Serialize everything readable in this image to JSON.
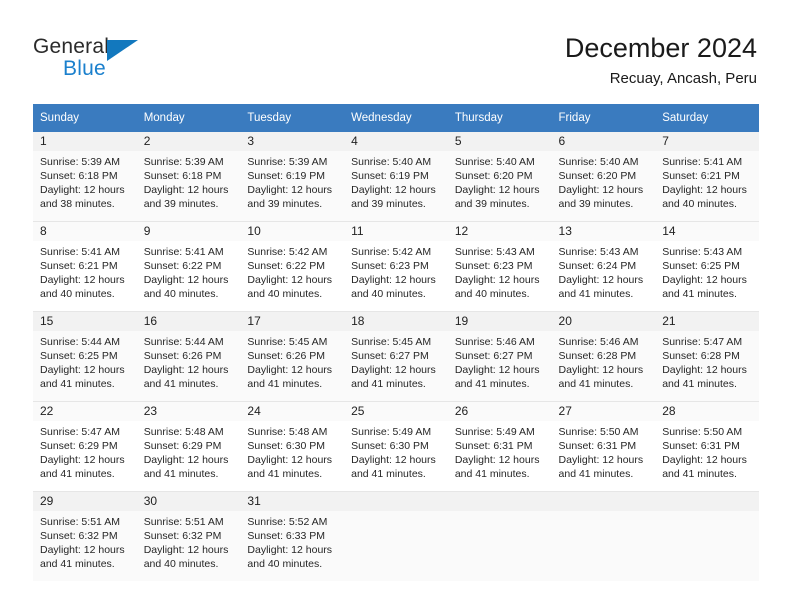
{
  "brand": {
    "name_part1": "General",
    "name_part2": "Blue",
    "triangle_color": "#1278be",
    "blue_color": "#1b80cd"
  },
  "header": {
    "title": "December 2024",
    "subtitle": "Recuay, Ancash, Peru"
  },
  "theme": {
    "header_bg": "#3a7bbf",
    "header_text": "#ffffff",
    "daynum_band": "#f2f2f2",
    "row_shaded": "#fafafa"
  },
  "weekdays": [
    "Sunday",
    "Monday",
    "Tuesday",
    "Wednesday",
    "Thursday",
    "Friday",
    "Saturday"
  ],
  "labels": {
    "sunrise_prefix": "Sunrise:",
    "sunset_prefix": "Sunset:",
    "daylight_prefix": "Daylight:"
  },
  "weeks": [
    [
      {
        "day": "1",
        "sunrise": "Sunrise: 5:39 AM",
        "sunset": "Sunset: 6:18 PM",
        "daylight1": "Daylight: 12 hours",
        "daylight2": "and 38 minutes."
      },
      {
        "day": "2",
        "sunrise": "Sunrise: 5:39 AM",
        "sunset": "Sunset: 6:18 PM",
        "daylight1": "Daylight: 12 hours",
        "daylight2": "and 39 minutes."
      },
      {
        "day": "3",
        "sunrise": "Sunrise: 5:39 AM",
        "sunset": "Sunset: 6:19 PM",
        "daylight1": "Daylight: 12 hours",
        "daylight2": "and 39 minutes."
      },
      {
        "day": "4",
        "sunrise": "Sunrise: 5:40 AM",
        "sunset": "Sunset: 6:19 PM",
        "daylight1": "Daylight: 12 hours",
        "daylight2": "and 39 minutes."
      },
      {
        "day": "5",
        "sunrise": "Sunrise: 5:40 AM",
        "sunset": "Sunset: 6:20 PM",
        "daylight1": "Daylight: 12 hours",
        "daylight2": "and 39 minutes."
      },
      {
        "day": "6",
        "sunrise": "Sunrise: 5:40 AM",
        "sunset": "Sunset: 6:20 PM",
        "daylight1": "Daylight: 12 hours",
        "daylight2": "and 39 minutes."
      },
      {
        "day": "7",
        "sunrise": "Sunrise: 5:41 AM",
        "sunset": "Sunset: 6:21 PM",
        "daylight1": "Daylight: 12 hours",
        "daylight2": "and 40 minutes."
      }
    ],
    [
      {
        "day": "8",
        "sunrise": "Sunrise: 5:41 AM",
        "sunset": "Sunset: 6:21 PM",
        "daylight1": "Daylight: 12 hours",
        "daylight2": "and 40 minutes."
      },
      {
        "day": "9",
        "sunrise": "Sunrise: 5:41 AM",
        "sunset": "Sunset: 6:22 PM",
        "daylight1": "Daylight: 12 hours",
        "daylight2": "and 40 minutes."
      },
      {
        "day": "10",
        "sunrise": "Sunrise: 5:42 AM",
        "sunset": "Sunset: 6:22 PM",
        "daylight1": "Daylight: 12 hours",
        "daylight2": "and 40 minutes."
      },
      {
        "day": "11",
        "sunrise": "Sunrise: 5:42 AM",
        "sunset": "Sunset: 6:23 PM",
        "daylight1": "Daylight: 12 hours",
        "daylight2": "and 40 minutes."
      },
      {
        "day": "12",
        "sunrise": "Sunrise: 5:43 AM",
        "sunset": "Sunset: 6:23 PM",
        "daylight1": "Daylight: 12 hours",
        "daylight2": "and 40 minutes."
      },
      {
        "day": "13",
        "sunrise": "Sunrise: 5:43 AM",
        "sunset": "Sunset: 6:24 PM",
        "daylight1": "Daylight: 12 hours",
        "daylight2": "and 41 minutes."
      },
      {
        "day": "14",
        "sunrise": "Sunrise: 5:43 AM",
        "sunset": "Sunset: 6:25 PM",
        "daylight1": "Daylight: 12 hours",
        "daylight2": "and 41 minutes."
      }
    ],
    [
      {
        "day": "15",
        "sunrise": "Sunrise: 5:44 AM",
        "sunset": "Sunset: 6:25 PM",
        "daylight1": "Daylight: 12 hours",
        "daylight2": "and 41 minutes."
      },
      {
        "day": "16",
        "sunrise": "Sunrise: 5:44 AM",
        "sunset": "Sunset: 6:26 PM",
        "daylight1": "Daylight: 12 hours",
        "daylight2": "and 41 minutes."
      },
      {
        "day": "17",
        "sunrise": "Sunrise: 5:45 AM",
        "sunset": "Sunset: 6:26 PM",
        "daylight1": "Daylight: 12 hours",
        "daylight2": "and 41 minutes."
      },
      {
        "day": "18",
        "sunrise": "Sunrise: 5:45 AM",
        "sunset": "Sunset: 6:27 PM",
        "daylight1": "Daylight: 12 hours",
        "daylight2": "and 41 minutes."
      },
      {
        "day": "19",
        "sunrise": "Sunrise: 5:46 AM",
        "sunset": "Sunset: 6:27 PM",
        "daylight1": "Daylight: 12 hours",
        "daylight2": "and 41 minutes."
      },
      {
        "day": "20",
        "sunrise": "Sunrise: 5:46 AM",
        "sunset": "Sunset: 6:28 PM",
        "daylight1": "Daylight: 12 hours",
        "daylight2": "and 41 minutes."
      },
      {
        "day": "21",
        "sunrise": "Sunrise: 5:47 AM",
        "sunset": "Sunset: 6:28 PM",
        "daylight1": "Daylight: 12 hours",
        "daylight2": "and 41 minutes."
      }
    ],
    [
      {
        "day": "22",
        "sunrise": "Sunrise: 5:47 AM",
        "sunset": "Sunset: 6:29 PM",
        "daylight1": "Daylight: 12 hours",
        "daylight2": "and 41 minutes."
      },
      {
        "day": "23",
        "sunrise": "Sunrise: 5:48 AM",
        "sunset": "Sunset: 6:29 PM",
        "daylight1": "Daylight: 12 hours",
        "daylight2": "and 41 minutes."
      },
      {
        "day": "24",
        "sunrise": "Sunrise: 5:48 AM",
        "sunset": "Sunset: 6:30 PM",
        "daylight1": "Daylight: 12 hours",
        "daylight2": "and 41 minutes."
      },
      {
        "day": "25",
        "sunrise": "Sunrise: 5:49 AM",
        "sunset": "Sunset: 6:30 PM",
        "daylight1": "Daylight: 12 hours",
        "daylight2": "and 41 minutes."
      },
      {
        "day": "26",
        "sunrise": "Sunrise: 5:49 AM",
        "sunset": "Sunset: 6:31 PM",
        "daylight1": "Daylight: 12 hours",
        "daylight2": "and 41 minutes."
      },
      {
        "day": "27",
        "sunrise": "Sunrise: 5:50 AM",
        "sunset": "Sunset: 6:31 PM",
        "daylight1": "Daylight: 12 hours",
        "daylight2": "and 41 minutes."
      },
      {
        "day": "28",
        "sunrise": "Sunrise: 5:50 AM",
        "sunset": "Sunset: 6:31 PM",
        "daylight1": "Daylight: 12 hours",
        "daylight2": "and 41 minutes."
      }
    ],
    [
      {
        "day": "29",
        "sunrise": "Sunrise: 5:51 AM",
        "sunset": "Sunset: 6:32 PM",
        "daylight1": "Daylight: 12 hours",
        "daylight2": "and 41 minutes."
      },
      {
        "day": "30",
        "sunrise": "Sunrise: 5:51 AM",
        "sunset": "Sunset: 6:32 PM",
        "daylight1": "Daylight: 12 hours",
        "daylight2": "and 40 minutes."
      },
      {
        "day": "31",
        "sunrise": "Sunrise: 5:52 AM",
        "sunset": "Sunset: 6:33 PM",
        "daylight1": "Daylight: 12 hours",
        "daylight2": "and 40 minutes."
      },
      {
        "day": "",
        "sunrise": "",
        "sunset": "",
        "daylight1": "",
        "daylight2": ""
      },
      {
        "day": "",
        "sunrise": "",
        "sunset": "",
        "daylight1": "",
        "daylight2": ""
      },
      {
        "day": "",
        "sunrise": "",
        "sunset": "",
        "daylight1": "",
        "daylight2": ""
      },
      {
        "day": "",
        "sunrise": "",
        "sunset": "",
        "daylight1": "",
        "daylight2": ""
      }
    ]
  ]
}
